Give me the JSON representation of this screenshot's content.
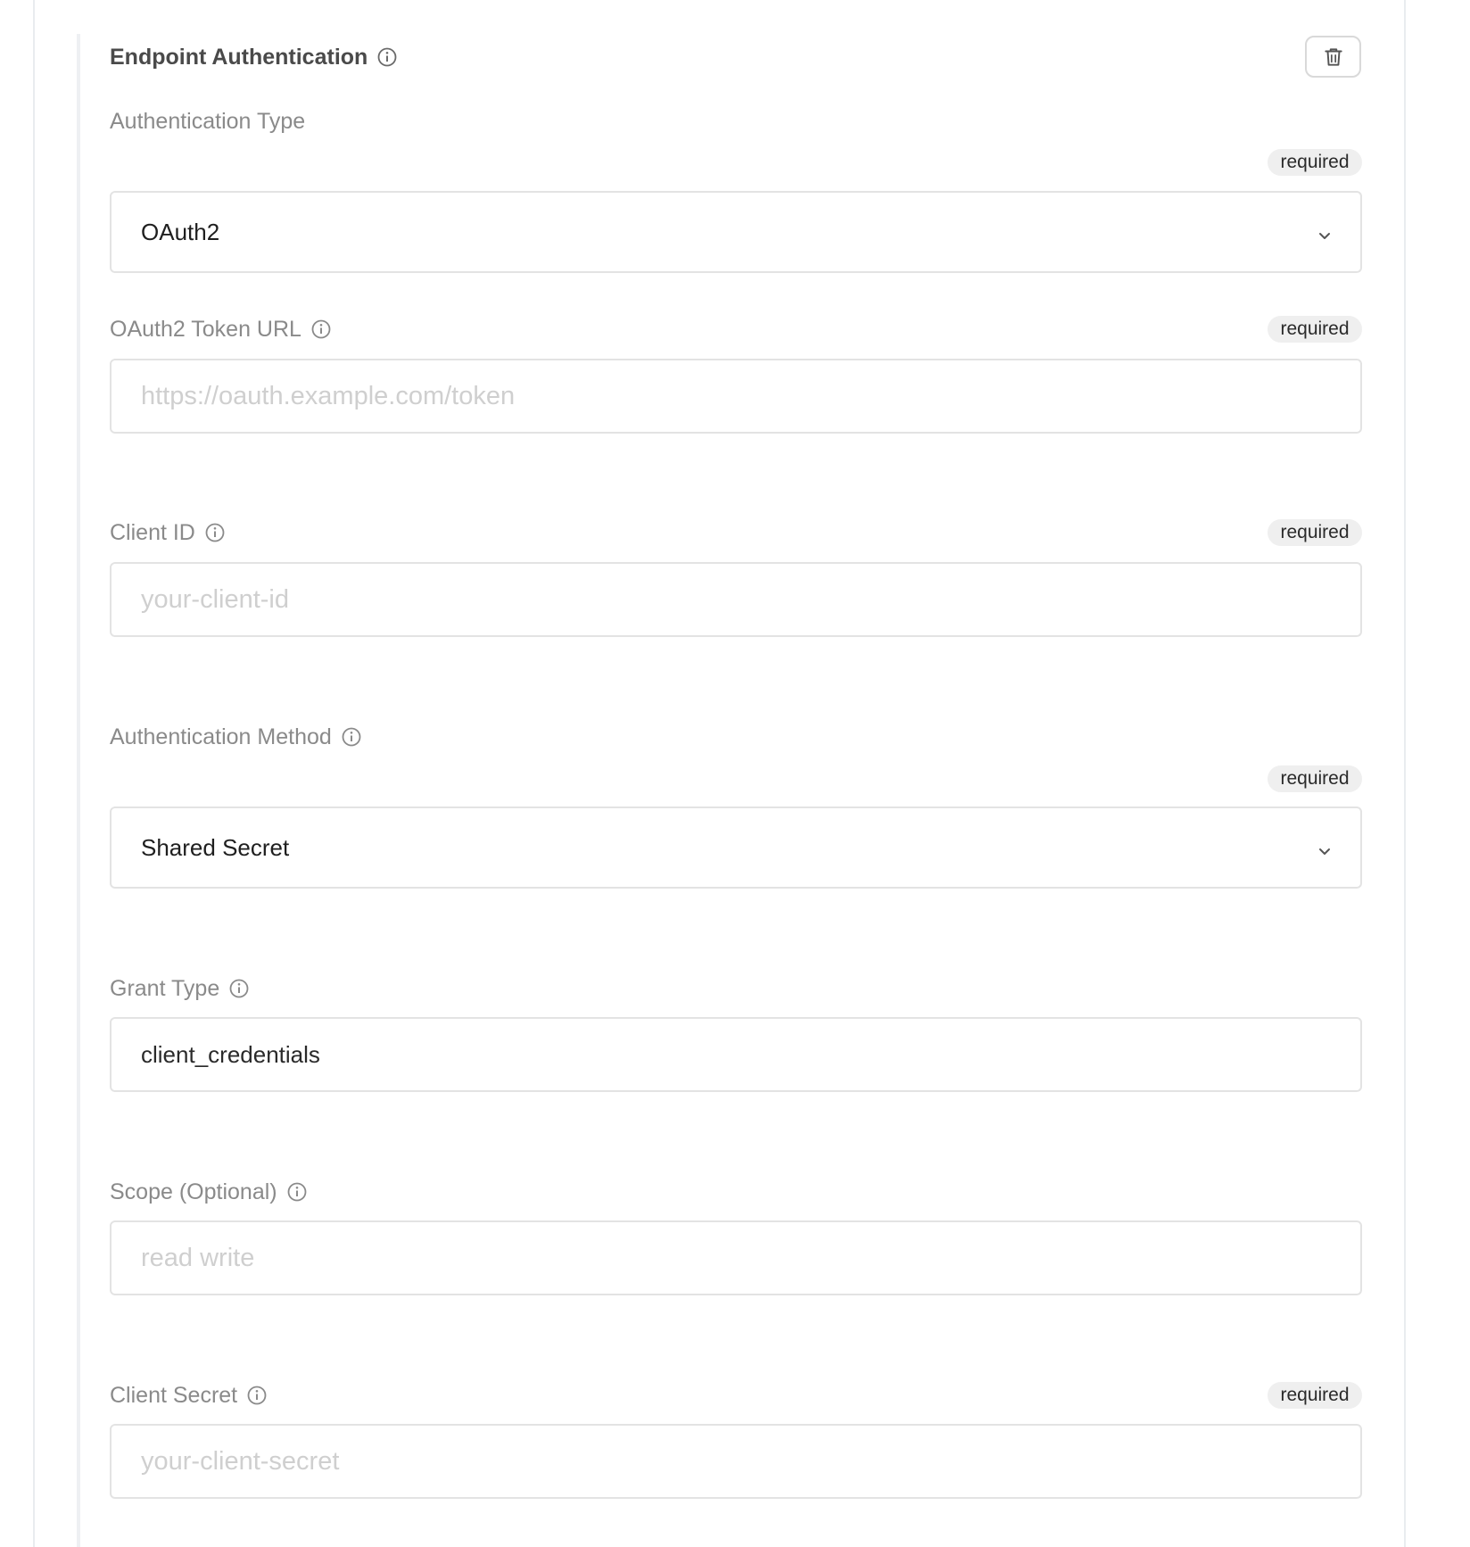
{
  "section": {
    "title": "Endpoint Authentication",
    "delete_icon": "trash-icon"
  },
  "fields": {
    "auth_type": {
      "label": "Authentication Type",
      "required": "required",
      "value": "OAuth2"
    },
    "token_url": {
      "label": "OAuth2 Token URL",
      "required": "required",
      "placeholder": "https://oauth.example.com/token",
      "value": ""
    },
    "client_id": {
      "label": "Client ID",
      "required": "required",
      "placeholder": "your-client-id",
      "value": ""
    },
    "auth_method": {
      "label": "Authentication Method",
      "required": "required",
      "value": "Shared Secret"
    },
    "grant_type": {
      "label": "Grant Type",
      "value": "client_credentials"
    },
    "scope": {
      "label": "Scope (Optional)",
      "placeholder": "read write",
      "value": ""
    },
    "client_secret": {
      "label": "Client Secret",
      "required": "required",
      "placeholder": "your-client-secret",
      "value": ""
    }
  },
  "icons": {
    "info": "info-icon",
    "chevron": "chevron-down-icon"
  },
  "colors": {
    "label": "#8a8a8a",
    "badge_bg": "#efefef",
    "border": "#e3e3e3",
    "placeholder": "#cfcfcf"
  }
}
